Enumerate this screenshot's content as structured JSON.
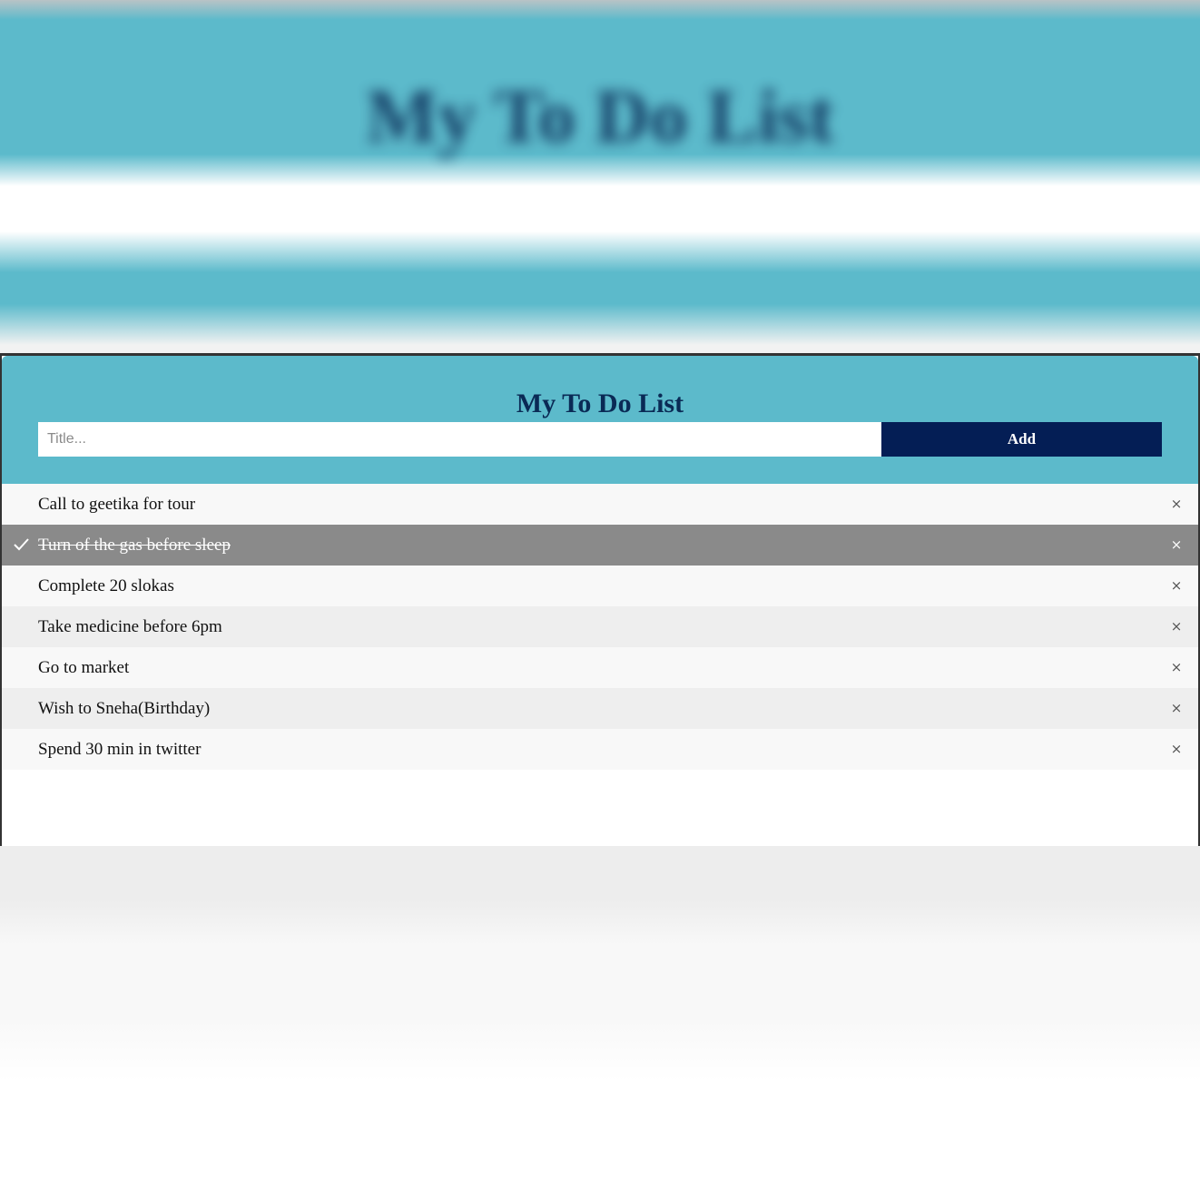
{
  "app": {
    "title": "My To Do List",
    "input_placeholder": "Title...",
    "add_label": "Add"
  },
  "colors": {
    "header_bg": "#5cbacb",
    "title_color": "#0a2a55",
    "add_button_bg": "#041e55",
    "checked_row_bg": "#8a8a8a"
  },
  "todos": [
    {
      "text": "Call to geetika for tour",
      "checked": false,
      "close": "×"
    },
    {
      "text": "Turn of the gas before sleep",
      "checked": true,
      "close": "×"
    },
    {
      "text": "Complete 20 slokas",
      "checked": false,
      "close": "×"
    },
    {
      "text": "Take medicine before 6pm",
      "checked": false,
      "close": "×"
    },
    {
      "text": "Go to market",
      "checked": false,
      "close": "×"
    },
    {
      "text": "Wish to Sneha(Birthday)",
      "checked": false,
      "close": "×"
    },
    {
      "text": "Spend 30 min in twitter",
      "checked": false,
      "close": "×"
    }
  ]
}
